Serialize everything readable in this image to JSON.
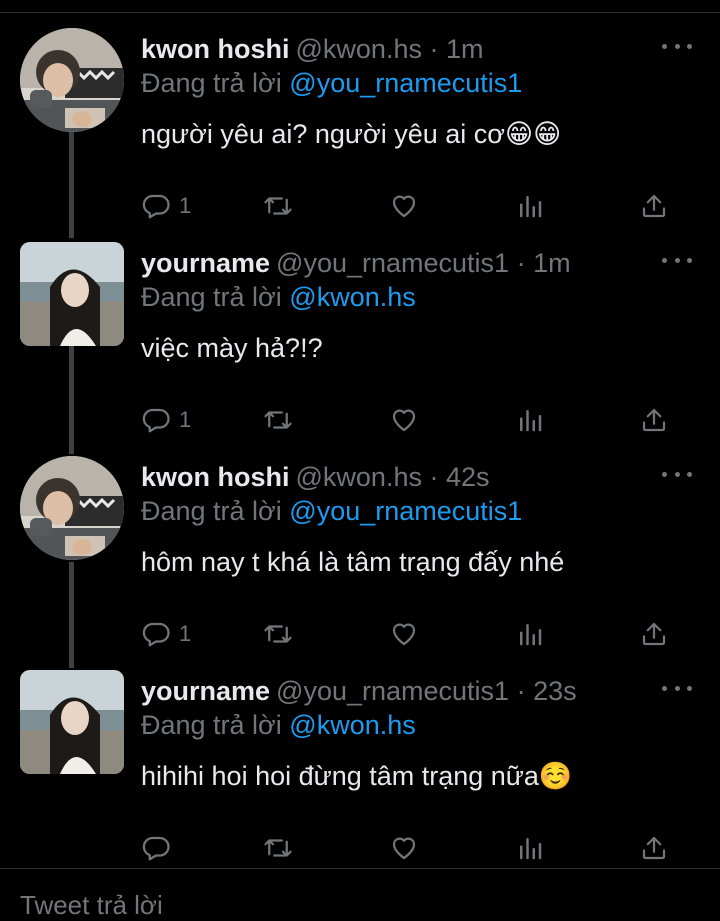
{
  "tweets": [
    {
      "name": "kwon hoshi",
      "handle": "@kwon.hs",
      "dot": "·",
      "time": "1m",
      "reply_prefix": "Đang trả lời",
      "reply_to": "@you_rnamecutis1",
      "text": "người yêu ai? người yêu ai cơ😁😁",
      "reply_count": "1"
    },
    {
      "name": "yourname",
      "handle": "@you_rnamecutis1",
      "dot": "·",
      "time": "1m",
      "reply_prefix": "Đang trả lời",
      "reply_to": "@kwon.hs",
      "text": "việc mày hả?!?",
      "reply_count": "1"
    },
    {
      "name": "kwon hoshi",
      "handle": "@kwon.hs",
      "dot": "·",
      "time": "42s",
      "reply_prefix": "Đang trả lời",
      "reply_to": "@you_rnamecutis1",
      "text": "hôm nay t khá là tâm trạng đấy nhé",
      "reply_count": "1"
    },
    {
      "name": "yourname",
      "handle": "@you_rnamecutis1",
      "dot": "·",
      "time": "23s",
      "reply_prefix": "Đang trả lời",
      "reply_to": "@kwon.hs",
      "text": "hihihi hoi hoi đừng tâm trạng nữa☺️",
      "reply_count": ""
    }
  ],
  "icons": {
    "reply": "reply-icon",
    "retweet": "retweet-icon",
    "like": "heart-icon",
    "views": "views-icon",
    "share": "share-icon",
    "more": "more-icon"
  },
  "reply_bar": {
    "placeholder": "Tweet trả lời"
  },
  "colors": {
    "background": "#000000",
    "text": "#e7e9ea",
    "muted": "#71767b",
    "link": "#1d9bf0"
  }
}
